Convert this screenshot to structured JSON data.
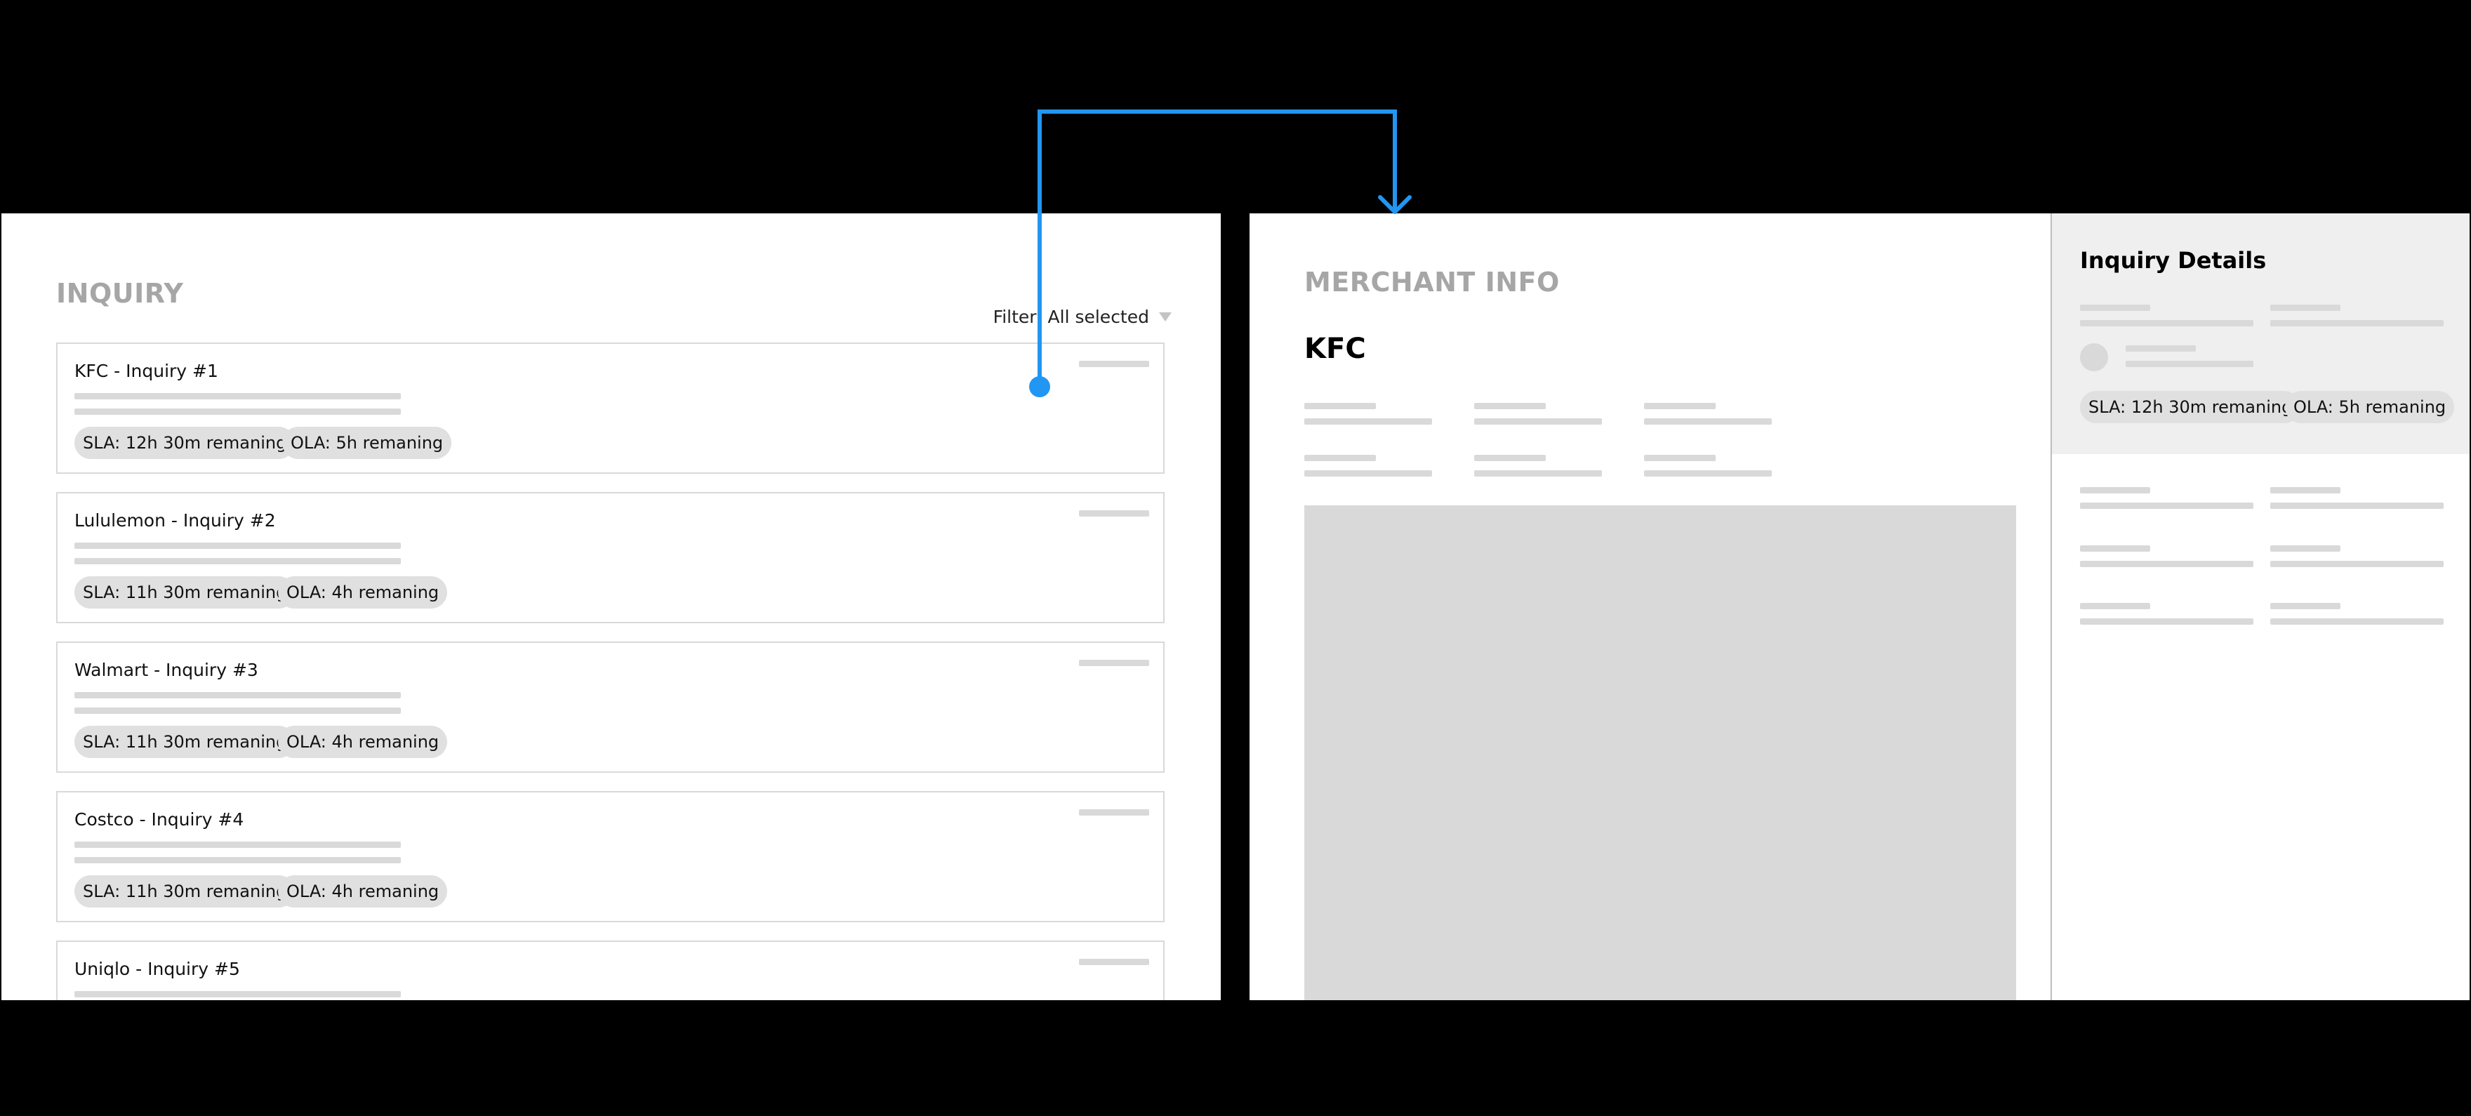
{
  "left_screen": {
    "title": "INQUIRY",
    "filter_label": "Filter: All selected",
    "inquiries": [
      {
        "name": "KFC - Inquiry #1",
        "sla": "SLA: 12h 30m remaning",
        "ola": "OLA: 5h remaning"
      },
      {
        "name": "Lululemon - Inquiry #2",
        "sla": "SLA: 11h 30m remaning",
        "ola": "OLA: 4h remaning"
      },
      {
        "name": "Walmart - Inquiry #3",
        "sla": "SLA: 11h 30m remaning",
        "ola": "OLA: 4h remaning"
      },
      {
        "name": "Costco - Inquiry #4",
        "sla": "SLA: 11h 30m remaning",
        "ola": "OLA: 4h remaning"
      },
      {
        "name": "Uniqlo - Inquiry #5",
        "sla": "",
        "ola": ""
      }
    ]
  },
  "right_screen": {
    "title": "MERCHANT INFO",
    "merchant_name": "KFC",
    "details_title": "Inquiry Details",
    "sla": "SLA: 12h 30m remaning",
    "ola": "OLA: 5h remaning"
  },
  "colors": {
    "connector": "#2196f3",
    "placeholder": "#d9d9d9",
    "section_title": "#a6a6a6"
  }
}
